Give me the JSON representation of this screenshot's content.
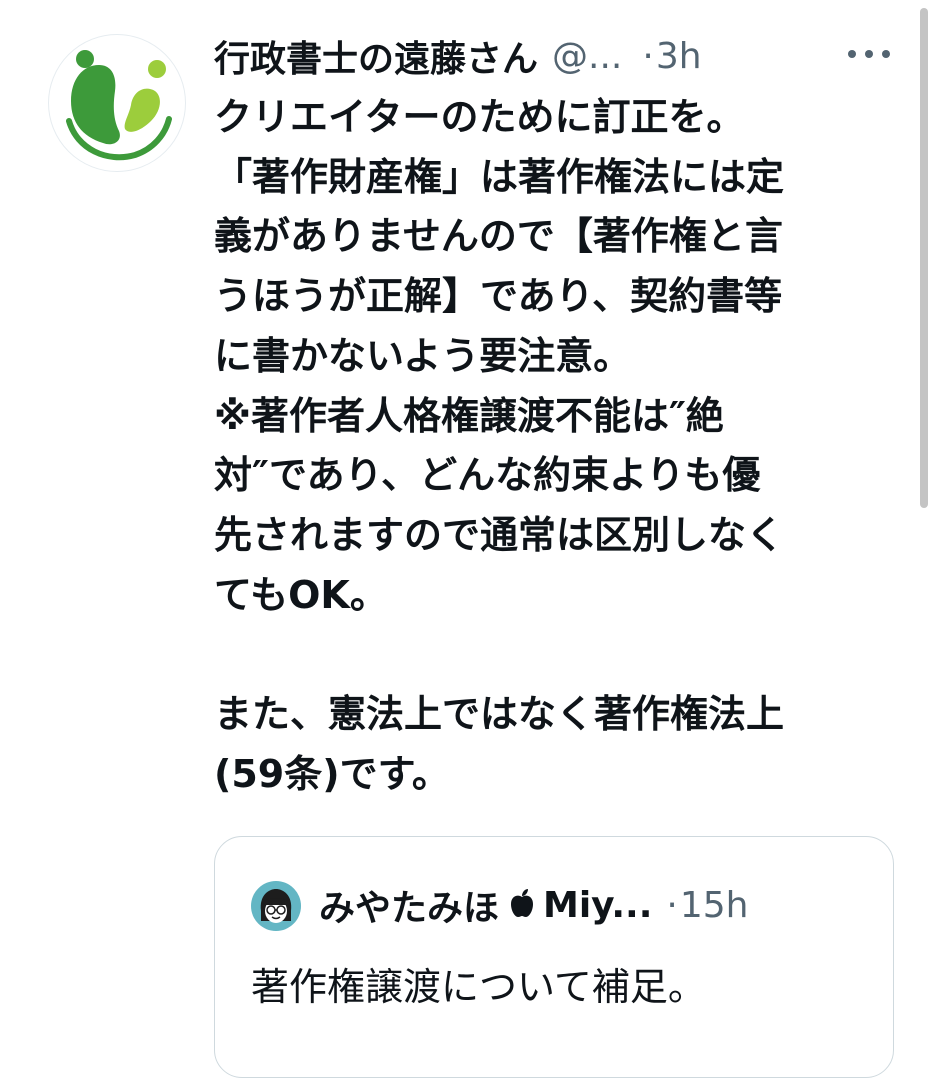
{
  "tweet": {
    "author_name": "行政書士の遠藤さん",
    "author_handle": "@...",
    "separator": "·",
    "time": "3h",
    "more_icon": "more-horizontal-icon",
    "avatar_icon": "green-logo-avatar",
    "body": "クリエイターのために訂正を。\n「著作財産権」は著作権法には定\n義がありませんので【著作権と言\nうほうが正解】であり、契約書等\nに書かないよう要注意。\n※著作者人格権譲渡不能は″絶\n対″であり、どんな約束よりも優\n先されますので通常は区別しなく\nてもOK。\n\nまた、憲法上ではなく著作権法上\n(59条)です。"
  },
  "quoted_tweet": {
    "author_name": "みやたみほ",
    "name_icon": "apple-logo-icon",
    "author_name_suffix": "Miy...",
    "separator": "·",
    "time": "15h",
    "body": "著作権譲渡について補足。"
  },
  "colors": {
    "text_primary": "#0f1419",
    "text_secondary": "#536471",
    "border": "#cfd9de",
    "logo_dark_green": "#3d9a3a",
    "logo_light_green": "#9ccd3c",
    "quote_avatar_bg": "#63b6c4"
  }
}
